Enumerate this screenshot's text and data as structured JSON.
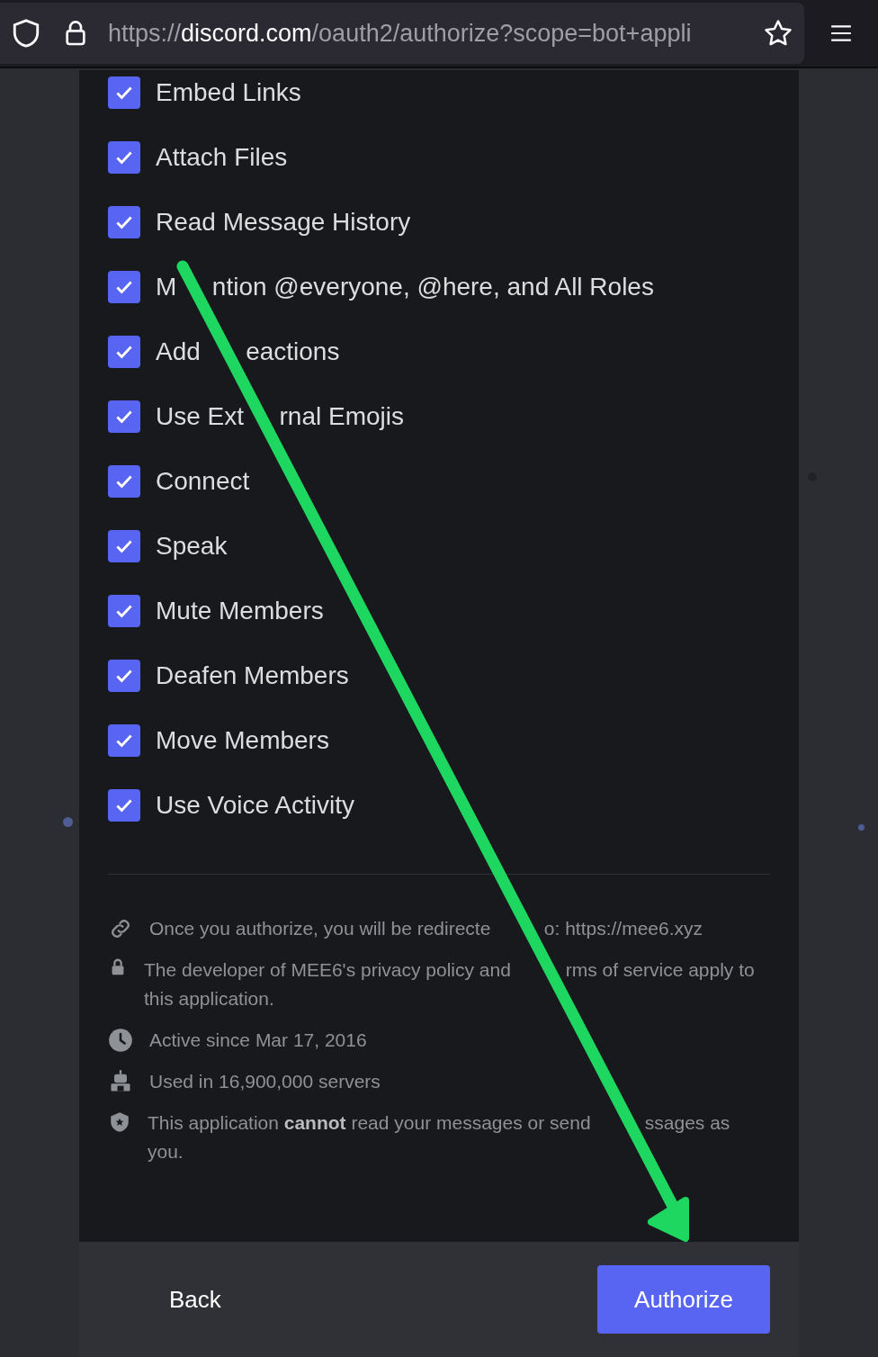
{
  "address_bar": {
    "url_start": "https://",
    "url_host": "discord.com",
    "url_rest": "/oauth2/authorize?scope=bot+appli"
  },
  "permissions": [
    {
      "parts": [
        "Embed Links"
      ],
      "checked": true
    },
    {
      "parts": [
        "Attach Files"
      ],
      "checked": true
    },
    {
      "parts": [
        "Read Message History"
      ],
      "checked": true
    },
    {
      "parts": [
        "M",
        "ntion @everyone, @here, and All Roles"
      ],
      "checked": true
    },
    {
      "parts": [
        "Add",
        "eactions"
      ],
      "checked": true
    },
    {
      "parts": [
        "Use Ext",
        "rnal Emojis"
      ],
      "checked": true
    },
    {
      "parts": [
        "Connect"
      ],
      "checked": true
    },
    {
      "parts": [
        "Speak"
      ],
      "checked": true
    },
    {
      "parts": [
        "Mute Members"
      ],
      "checked": true
    },
    {
      "parts": [
        "Deafen Members"
      ],
      "checked": true
    },
    {
      "parts": [
        "Move Members"
      ],
      "checked": true
    },
    {
      "parts": [
        "Use Voice Activity"
      ],
      "checked": true
    }
  ],
  "info": [
    {
      "kind": "link",
      "lines": [
        [
          "Once you authorize, you will be redirecte",
          "o: https://mee6.xyz"
        ]
      ]
    },
    {
      "kind": "lock",
      "lines": [
        [
          "The developer of MEE6's privacy policy and",
          "rms of service apply to"
        ],
        [
          "this application."
        ]
      ]
    },
    {
      "kind": "clock",
      "lines": [
        [
          "Active since Mar 17, 2016"
        ]
      ]
    },
    {
      "kind": "robot",
      "lines": [
        [
          "Used in 16,900,000 servers"
        ]
      ]
    },
    {
      "kind": "shield",
      "lines": [
        [
          "This application **cannot** read your messages or send",
          "ssages as"
        ],
        [
          "you."
        ]
      ]
    }
  ],
  "footer": {
    "back": "Back",
    "authorize": "Authorize"
  }
}
